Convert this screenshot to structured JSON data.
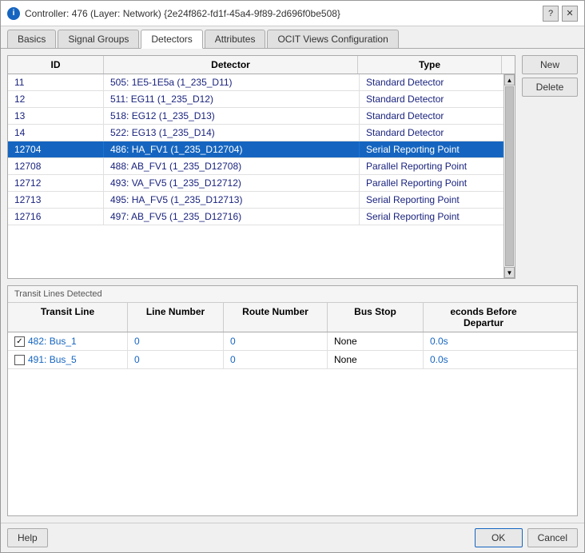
{
  "window": {
    "title": "Controller: 476 (Layer: Network) {2e24f862-fd1f-45a4-9f89-2d696f0be508}",
    "icon": "i",
    "help_btn": "?",
    "close_btn": "✕"
  },
  "tabs": [
    {
      "label": "Basics",
      "active": false
    },
    {
      "label": "Signal Groups",
      "active": false
    },
    {
      "label": "Detectors",
      "active": true
    },
    {
      "label": "Attributes",
      "active": false
    },
    {
      "label": "OCIT Views Configuration",
      "active": false
    }
  ],
  "table": {
    "columns": [
      "ID",
      "Detector",
      "Type"
    ],
    "rows": [
      {
        "id": "11",
        "detector": "505: 1E5-1E5a (1_235_D11)",
        "type": "Standard Detector",
        "selected": false
      },
      {
        "id": "12",
        "detector": "511: EG11 (1_235_D12)",
        "type": "Standard Detector",
        "selected": false
      },
      {
        "id": "13",
        "detector": "518: EG12 (1_235_D13)",
        "type": "Standard Detector",
        "selected": false
      },
      {
        "id": "14",
        "detector": "522: EG13 (1_235_D14)",
        "type": "Standard Detector",
        "selected": false
      },
      {
        "id": "12704",
        "detector": "486: HA_FV1 (1_235_D12704)",
        "type": "Serial Reporting Point",
        "selected": true
      },
      {
        "id": "12708",
        "detector": "488: AB_FV1 (1_235_D12708)",
        "type": "Parallel Reporting Point",
        "selected": false
      },
      {
        "id": "12712",
        "detector": "493: VA_FV5 (1_235_D12712)",
        "type": "Parallel Reporting Point",
        "selected": false
      },
      {
        "id": "12713",
        "detector": "495: HA_FV5 (1_235_D12713)",
        "type": "Serial Reporting Point",
        "selected": false
      },
      {
        "id": "12716",
        "detector": "497: AB_FV5 (1_235_D12716)",
        "type": "Serial Reporting Point",
        "selected": false
      }
    ],
    "new_btn": "New",
    "delete_btn": "Delete"
  },
  "transit": {
    "section_title": "Transit Lines Detected",
    "columns": [
      "Transit Line",
      "Line Number",
      "Route Number",
      "Bus Stop",
      "econds Before Departur"
    ],
    "rows": [
      {
        "checked": true,
        "transit_line": "482: Bus_1",
        "line_number": "0",
        "route_number": "0",
        "bus_stop": "None",
        "seconds": "0.0s"
      },
      {
        "checked": false,
        "transit_line": "491: Bus_5",
        "line_number": "0",
        "route_number": "0",
        "bus_stop": "None",
        "seconds": "0.0s"
      }
    ]
  },
  "footer": {
    "help_btn": "Help",
    "ok_btn": "OK",
    "cancel_btn": "Cancel"
  }
}
